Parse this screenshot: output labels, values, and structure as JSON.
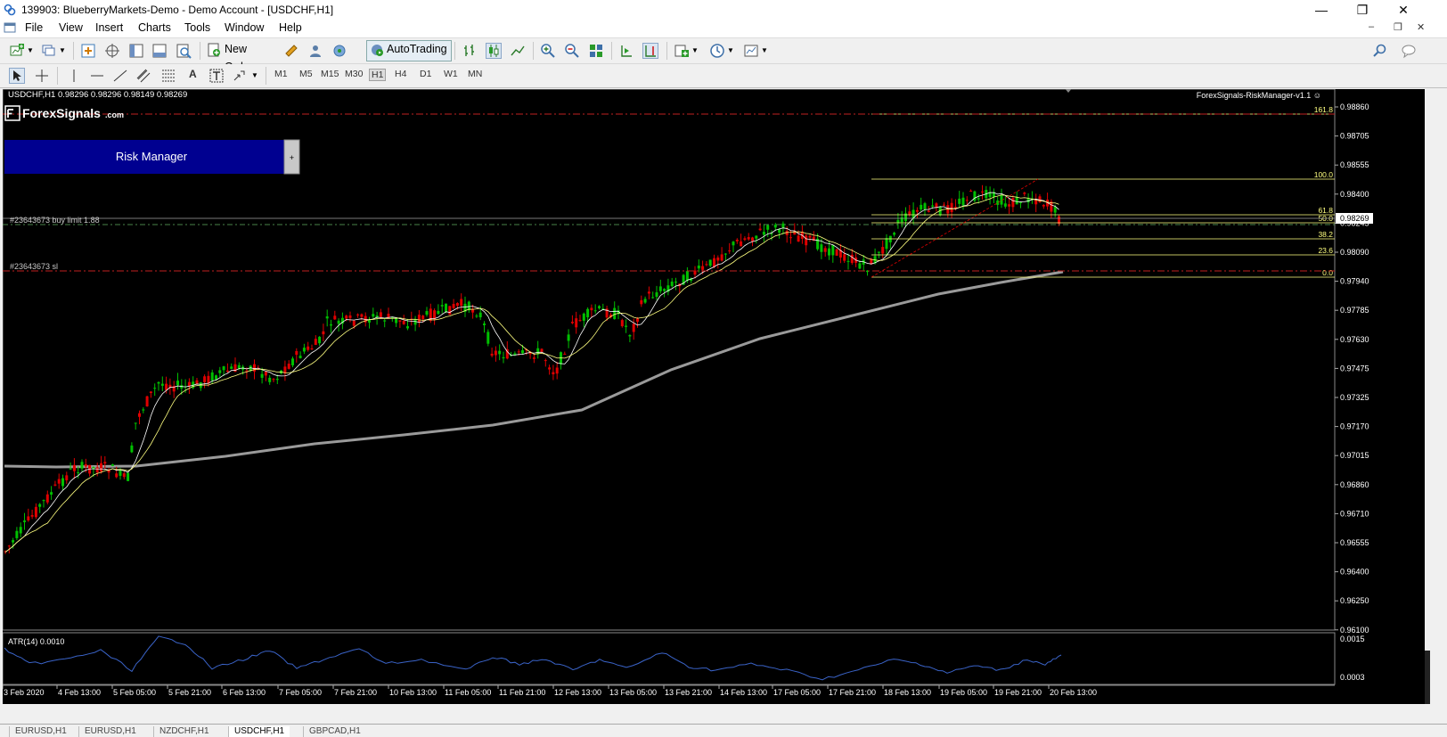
{
  "window": {
    "title": "139903: BlueberryMarkets-Demo - Demo Account - [USDCHF,H1]",
    "minimize": "—",
    "restore": "❐",
    "close": "✕"
  },
  "menu": {
    "items": [
      "File",
      "View",
      "Insert",
      "Charts",
      "Tools",
      "Window",
      "Help"
    ],
    "mdi_minimize": "–",
    "mdi_restore": "❐",
    "mdi_close": "✕"
  },
  "toolbar": {
    "new_order": "New Order",
    "autotrading": "AutoTrading"
  },
  "timeframes": [
    "M1",
    "M5",
    "M15",
    "M30",
    "H1",
    "H4",
    "D1",
    "W1",
    "MN"
  ],
  "active_timeframe": "H1",
  "chart": {
    "symbol_info": "USDCHF,H1  0.98296 0.98296 0.98149 0.98269",
    "brand_name": "ForexSignals",
    "brand_suffix": ".com",
    "ea_name": "ForexSignals-RiskManager-v1.1 ☺",
    "risk_manager_label": "Risk Manager",
    "risk_manager_toggle": "+",
    "order_buy_limit_label": "#23643673 buy limit 1.88",
    "order_sl_label": "#23643673 sl",
    "current_price": "0.98269",
    "price_labels": [
      "0.98860",
      "0.98705",
      "0.98555",
      "0.98400",
      "0.98245",
      "0.98090",
      "0.97940",
      "0.97785",
      "0.97630",
      "0.97475",
      "0.97325",
      "0.97170",
      "0.97015",
      "0.96860",
      "0.96710",
      "0.96555",
      "0.96400",
      "0.96250",
      "0.96100"
    ],
    "fib_levels": [
      "161.8",
      "100.0",
      "61.8",
      "50.0",
      "38.2",
      "23.6",
      "0.0"
    ],
    "time_labels": [
      "3 Feb 2020",
      "4 Feb 13:00",
      "5 Feb 05:00",
      "5 Feb 21:00",
      "6 Feb 13:00",
      "7 Feb 05:00",
      "7 Feb 21:00",
      "10 Feb 13:00",
      "11 Feb 05:00",
      "11 Feb 21:00",
      "12 Feb 13:00",
      "13 Feb 05:00",
      "13 Feb 21:00",
      "14 Feb 13:00",
      "17 Feb 05:00",
      "17 Feb 21:00",
      "18 Feb 13:00",
      "19 Feb 05:00",
      "19 Feb 21:00",
      "20 Feb 13:00"
    ],
    "atr_label": "ATR(14) 0.0010",
    "atr_axis": [
      "0.0015",
      "0.0003"
    ]
  },
  "tabs": [
    "EURUSD,H1",
    "EURUSD,H1",
    "NZDCHF,H1",
    "USDCHF,H1",
    "GBPCAD,H1"
  ],
  "active_tab": "USDCHF,H1",
  "colors": {
    "background": "#000000",
    "bull_candle": "#00c000",
    "bear_candle": "#e00000",
    "ma_slow": "#9a9a9a",
    "ma_fast": "#ffff80",
    "ma_mid": "#ffffff",
    "atr_line": "#3a63c8",
    "fib_line": "#ffff80",
    "risk_manager_bg": "#000090"
  }
}
